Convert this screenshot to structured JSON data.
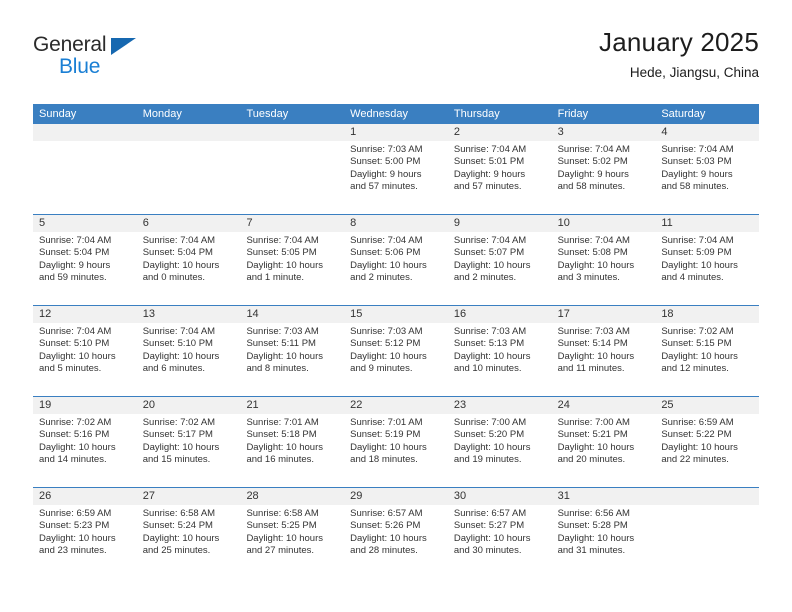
{
  "brand": {
    "name_top": "General",
    "name_bottom": "Blue",
    "accent_color": "#1a7fd4",
    "triangle_color": "#1668b0"
  },
  "header": {
    "title": "January 2025",
    "location": "Hede, Jiangsu, China"
  },
  "theme": {
    "header_row_bg": "#3a7fc1",
    "day_strip_bg": "#f1f1f1",
    "grid_line": "#3a7fc1",
    "text": "#333333"
  },
  "calendar": {
    "weekdays": [
      "Sunday",
      "Monday",
      "Tuesday",
      "Wednesday",
      "Thursday",
      "Friday",
      "Saturday"
    ],
    "weeks": [
      [
        {
          "day": "",
          "empty": true
        },
        {
          "day": "",
          "empty": true
        },
        {
          "day": "",
          "empty": true
        },
        {
          "day": "1",
          "sunrise": "Sunrise: 7:03 AM",
          "sunset": "Sunset: 5:00 PM",
          "daylight1": "Daylight: 9 hours",
          "daylight2": "and 57 minutes."
        },
        {
          "day": "2",
          "sunrise": "Sunrise: 7:04 AM",
          "sunset": "Sunset: 5:01 PM",
          "daylight1": "Daylight: 9 hours",
          "daylight2": "and 57 minutes."
        },
        {
          "day": "3",
          "sunrise": "Sunrise: 7:04 AM",
          "sunset": "Sunset: 5:02 PM",
          "daylight1": "Daylight: 9 hours",
          "daylight2": "and 58 minutes."
        },
        {
          "day": "4",
          "sunrise": "Sunrise: 7:04 AM",
          "sunset": "Sunset: 5:03 PM",
          "daylight1": "Daylight: 9 hours",
          "daylight2": "and 58 minutes."
        }
      ],
      [
        {
          "day": "5",
          "sunrise": "Sunrise: 7:04 AM",
          "sunset": "Sunset: 5:04 PM",
          "daylight1": "Daylight: 9 hours",
          "daylight2": "and 59 minutes."
        },
        {
          "day": "6",
          "sunrise": "Sunrise: 7:04 AM",
          "sunset": "Sunset: 5:04 PM",
          "daylight1": "Daylight: 10 hours",
          "daylight2": "and 0 minutes."
        },
        {
          "day": "7",
          "sunrise": "Sunrise: 7:04 AM",
          "sunset": "Sunset: 5:05 PM",
          "daylight1": "Daylight: 10 hours",
          "daylight2": "and 1 minute."
        },
        {
          "day": "8",
          "sunrise": "Sunrise: 7:04 AM",
          "sunset": "Sunset: 5:06 PM",
          "daylight1": "Daylight: 10 hours",
          "daylight2": "and 2 minutes."
        },
        {
          "day": "9",
          "sunrise": "Sunrise: 7:04 AM",
          "sunset": "Sunset: 5:07 PM",
          "daylight1": "Daylight: 10 hours",
          "daylight2": "and 2 minutes."
        },
        {
          "day": "10",
          "sunrise": "Sunrise: 7:04 AM",
          "sunset": "Sunset: 5:08 PM",
          "daylight1": "Daylight: 10 hours",
          "daylight2": "and 3 minutes."
        },
        {
          "day": "11",
          "sunrise": "Sunrise: 7:04 AM",
          "sunset": "Sunset: 5:09 PM",
          "daylight1": "Daylight: 10 hours",
          "daylight2": "and 4 minutes."
        }
      ],
      [
        {
          "day": "12",
          "sunrise": "Sunrise: 7:04 AM",
          "sunset": "Sunset: 5:10 PM",
          "daylight1": "Daylight: 10 hours",
          "daylight2": "and 5 minutes."
        },
        {
          "day": "13",
          "sunrise": "Sunrise: 7:04 AM",
          "sunset": "Sunset: 5:10 PM",
          "daylight1": "Daylight: 10 hours",
          "daylight2": "and 6 minutes."
        },
        {
          "day": "14",
          "sunrise": "Sunrise: 7:03 AM",
          "sunset": "Sunset: 5:11 PM",
          "daylight1": "Daylight: 10 hours",
          "daylight2": "and 8 minutes."
        },
        {
          "day": "15",
          "sunrise": "Sunrise: 7:03 AM",
          "sunset": "Sunset: 5:12 PM",
          "daylight1": "Daylight: 10 hours",
          "daylight2": "and 9 minutes."
        },
        {
          "day": "16",
          "sunrise": "Sunrise: 7:03 AM",
          "sunset": "Sunset: 5:13 PM",
          "daylight1": "Daylight: 10 hours",
          "daylight2": "and 10 minutes."
        },
        {
          "day": "17",
          "sunrise": "Sunrise: 7:03 AM",
          "sunset": "Sunset: 5:14 PM",
          "daylight1": "Daylight: 10 hours",
          "daylight2": "and 11 minutes."
        },
        {
          "day": "18",
          "sunrise": "Sunrise: 7:02 AM",
          "sunset": "Sunset: 5:15 PM",
          "daylight1": "Daylight: 10 hours",
          "daylight2": "and 12 minutes."
        }
      ],
      [
        {
          "day": "19",
          "sunrise": "Sunrise: 7:02 AM",
          "sunset": "Sunset: 5:16 PM",
          "daylight1": "Daylight: 10 hours",
          "daylight2": "and 14 minutes."
        },
        {
          "day": "20",
          "sunrise": "Sunrise: 7:02 AM",
          "sunset": "Sunset: 5:17 PM",
          "daylight1": "Daylight: 10 hours",
          "daylight2": "and 15 minutes."
        },
        {
          "day": "21",
          "sunrise": "Sunrise: 7:01 AM",
          "sunset": "Sunset: 5:18 PM",
          "daylight1": "Daylight: 10 hours",
          "daylight2": "and 16 minutes."
        },
        {
          "day": "22",
          "sunrise": "Sunrise: 7:01 AM",
          "sunset": "Sunset: 5:19 PM",
          "daylight1": "Daylight: 10 hours",
          "daylight2": "and 18 minutes."
        },
        {
          "day": "23",
          "sunrise": "Sunrise: 7:00 AM",
          "sunset": "Sunset: 5:20 PM",
          "daylight1": "Daylight: 10 hours",
          "daylight2": "and 19 minutes."
        },
        {
          "day": "24",
          "sunrise": "Sunrise: 7:00 AM",
          "sunset": "Sunset: 5:21 PM",
          "daylight1": "Daylight: 10 hours",
          "daylight2": "and 20 minutes."
        },
        {
          "day": "25",
          "sunrise": "Sunrise: 6:59 AM",
          "sunset": "Sunset: 5:22 PM",
          "daylight1": "Daylight: 10 hours",
          "daylight2": "and 22 minutes."
        }
      ],
      [
        {
          "day": "26",
          "sunrise": "Sunrise: 6:59 AM",
          "sunset": "Sunset: 5:23 PM",
          "daylight1": "Daylight: 10 hours",
          "daylight2": "and 23 minutes."
        },
        {
          "day": "27",
          "sunrise": "Sunrise: 6:58 AM",
          "sunset": "Sunset: 5:24 PM",
          "daylight1": "Daylight: 10 hours",
          "daylight2": "and 25 minutes."
        },
        {
          "day": "28",
          "sunrise": "Sunrise: 6:58 AM",
          "sunset": "Sunset: 5:25 PM",
          "daylight1": "Daylight: 10 hours",
          "daylight2": "and 27 minutes."
        },
        {
          "day": "29",
          "sunrise": "Sunrise: 6:57 AM",
          "sunset": "Sunset: 5:26 PM",
          "daylight1": "Daylight: 10 hours",
          "daylight2": "and 28 minutes."
        },
        {
          "day": "30",
          "sunrise": "Sunrise: 6:57 AM",
          "sunset": "Sunset: 5:27 PM",
          "daylight1": "Daylight: 10 hours",
          "daylight2": "and 30 minutes."
        },
        {
          "day": "31",
          "sunrise": "Sunrise: 6:56 AM",
          "sunset": "Sunset: 5:28 PM",
          "daylight1": "Daylight: 10 hours",
          "daylight2": "and 31 minutes."
        },
        {
          "day": "",
          "empty": true
        }
      ]
    ]
  }
}
